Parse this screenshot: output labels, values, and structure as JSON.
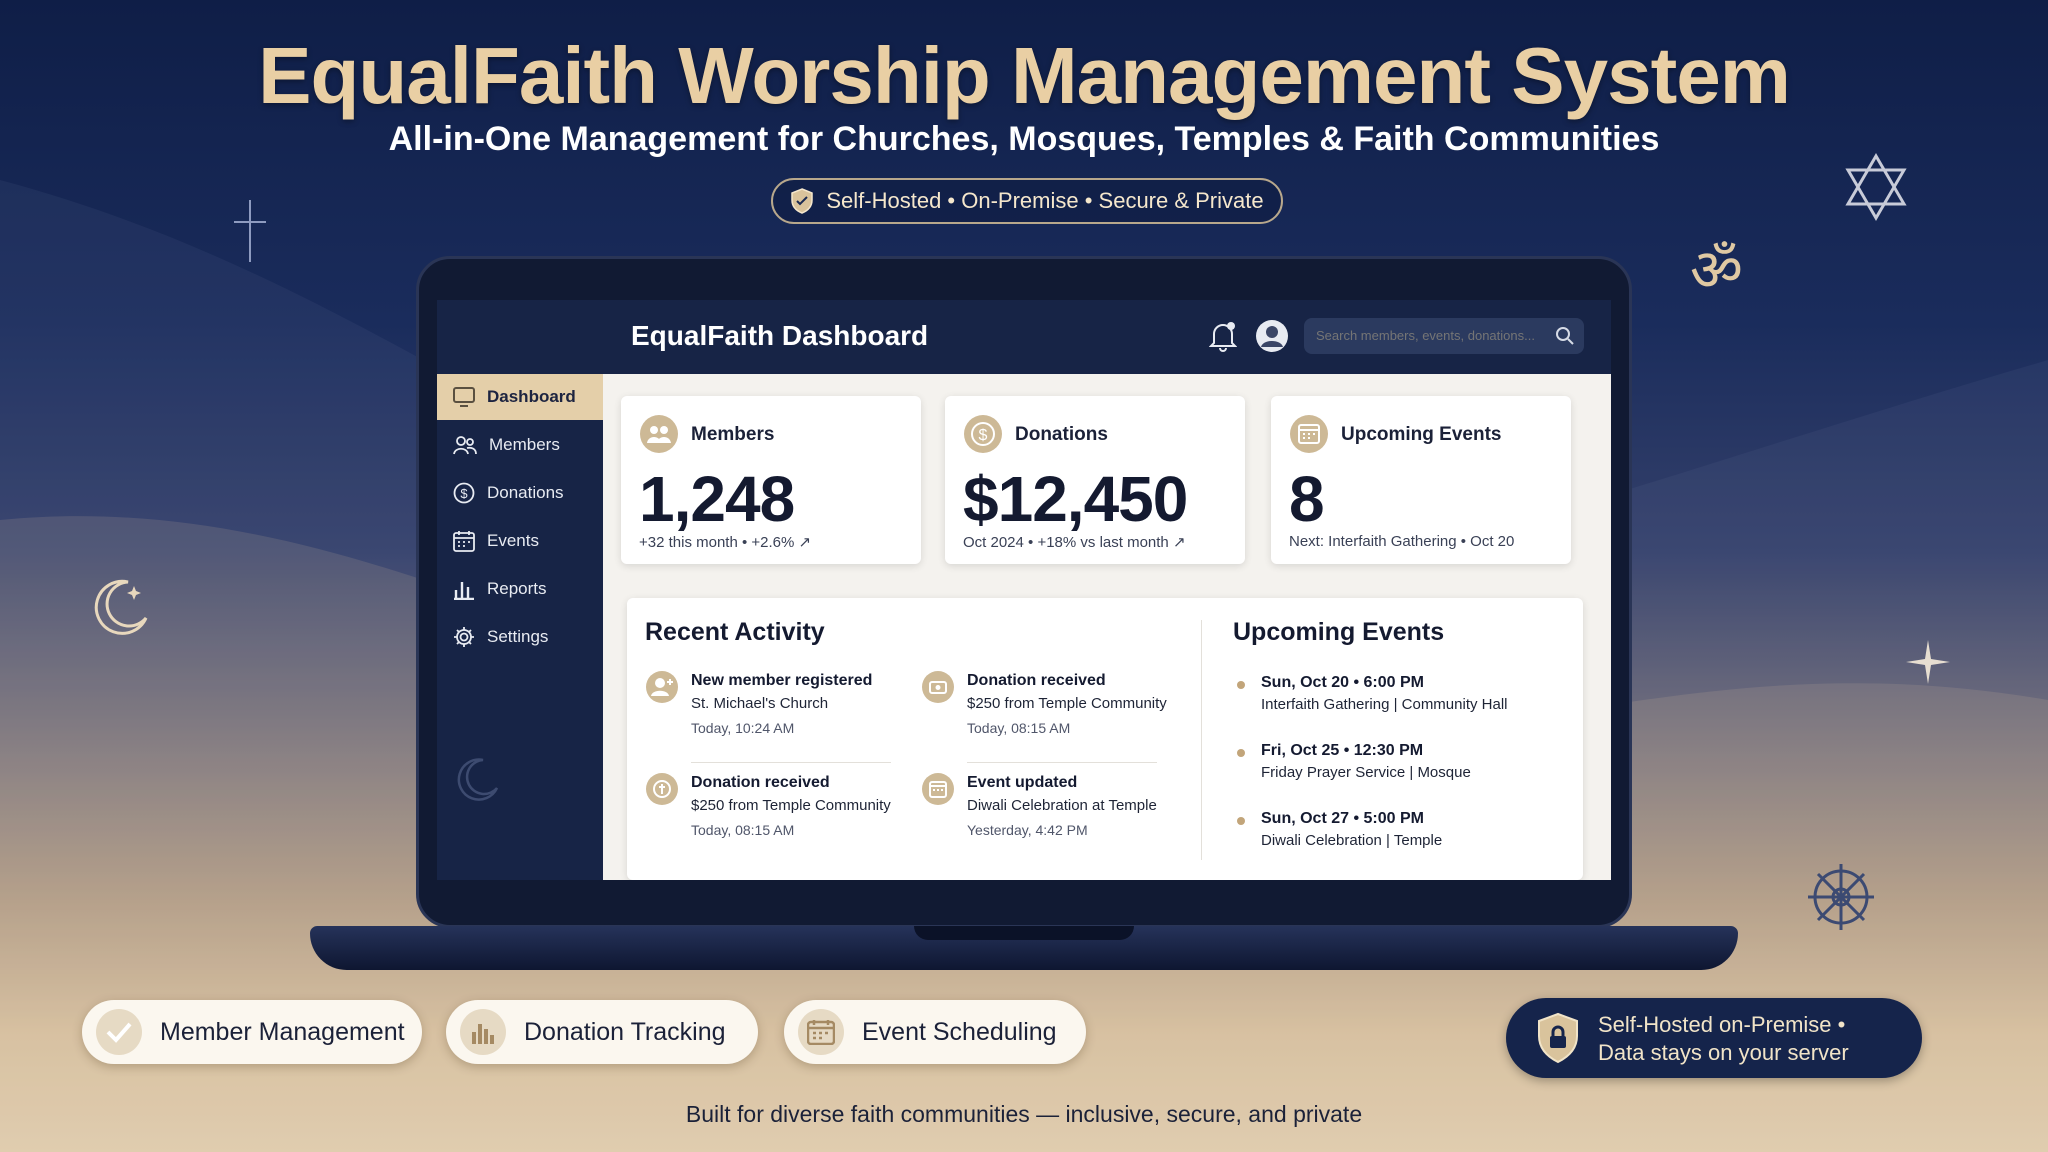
{
  "hero": {
    "title": "EqualFaith Worship Management System",
    "subtitle": "All-in-One Management for Churches, Mosques, Temples & Faith Communities",
    "badge": "Self-Hosted • On-Premise • Secure & Private"
  },
  "app": {
    "title": "EqualFaith Dashboard",
    "search_placeholder": "Search members, events, donations..."
  },
  "sidebar": {
    "items": [
      {
        "label": "Dashboard",
        "icon": "dashboard-icon",
        "active": true
      },
      {
        "label": "Members",
        "icon": "members-icon"
      },
      {
        "label": "Donations",
        "icon": "dollar-icon"
      },
      {
        "label": "Events",
        "icon": "calendar-icon"
      },
      {
        "label": "Reports",
        "icon": "bar-chart-icon"
      },
      {
        "label": "Settings",
        "icon": "gear-icon"
      }
    ]
  },
  "stats": [
    {
      "label": "Members",
      "value": "1,248",
      "sub": "+32 this month • +2.6% ↗",
      "icon": "members-icon"
    },
    {
      "label": "Donations",
      "value": "$12,450",
      "sub": "Oct 2024 • +18% vs last month ↗",
      "icon": "dollar-icon"
    },
    {
      "label": "Upcoming Events",
      "value": "8",
      "sub": "Next: Interfaith Gathering • Oct 20",
      "icon": "calendar-icon"
    }
  ],
  "recent_activity": {
    "title": "Recent Activity",
    "items": [
      {
        "title": "New member registered",
        "desc": "St. Michael's Church",
        "time": "Today, 10:24 AM",
        "icon": "user-add-icon"
      },
      {
        "title": "Donation received",
        "desc": "$250 from Temple Community",
        "time": "Today, 08:15 AM",
        "icon": "donation-icon"
      },
      {
        "title": "Donation received",
        "desc": "$250 from Temple Community",
        "time": "Today, 08:15 AM",
        "icon": "donation-icon"
      },
      {
        "title": "Event updated",
        "desc": "Diwali Celebration at Temple",
        "time": "Yesterday, 4:42 PM",
        "icon": "calendar-icon"
      }
    ]
  },
  "upcoming_events": {
    "title": "Upcoming Events",
    "items": [
      {
        "when": "Sun, Oct 20 • 6:00 PM",
        "what": "Interfaith Gathering | Community Hall"
      },
      {
        "when": "Fri, Oct 25 • 12:30 PM",
        "what": "Friday Prayer Service | Mosque"
      },
      {
        "when": "Sun, Oct 27 • 5:00 PM",
        "what": "Diwali Celebration | Temple"
      }
    ]
  },
  "features": [
    {
      "label": "Member Management",
      "icon": "check-icon"
    },
    {
      "label": "Donation Tracking",
      "icon": "bar-chart-icon"
    },
    {
      "label": "Event Scheduling",
      "icon": "calendar-icon"
    }
  ],
  "self_hosted": {
    "line1": "Self-Hosted on-Premise •",
    "line2": "Data stays on your server"
  },
  "footer": "Built for diverse faith communities — inclusive, secure, and private",
  "colors": {
    "navy": "#172446",
    "gold": "#e4cfa9",
    "title_gold": "#e9cfa4"
  }
}
